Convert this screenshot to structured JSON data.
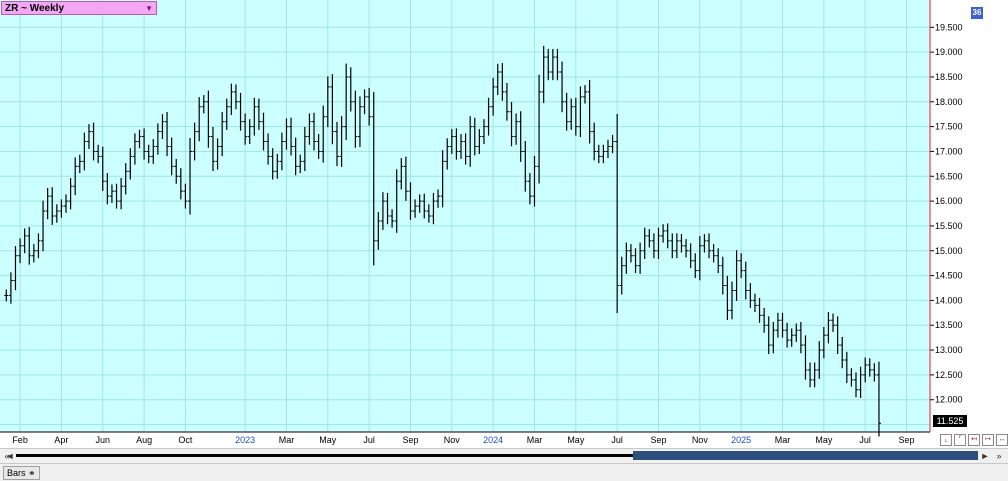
{
  "title": "ZR ~ Weekly",
  "badge": "36",
  "last_price_label": "11.525",
  "status_tab_label": "Bars",
  "status_tab_icon": "chain-link-icon",
  "nav": {
    "left_double": "«",
    "left": "◄",
    "right": "►",
    "right_double": "»"
  },
  "colors": {
    "plot_bg": "#ccffff",
    "grid": "#9fe6e6",
    "bars": "#000000",
    "cursor_line": "#e02020",
    "title_bg": "#f3a6f3"
  },
  "chart_data": {
    "type": "ohlc",
    "title": "ZR ~ Weekly",
    "xlabel": "",
    "ylabel": "",
    "y_axis_position": "right",
    "ylim": [
      11.35,
      20.05
    ],
    "yticks": [
      11.5,
      12.0,
      12.5,
      13.0,
      13.5,
      14.0,
      14.5,
      15.0,
      15.5,
      16.0,
      16.5,
      17.0,
      17.5,
      18.0,
      18.5,
      19.0,
      19.5
    ],
    "ytick_labels": [
      "",
      "12.000",
      "12.500",
      "13.000",
      "13.500",
      "14.000",
      "14.500",
      "15.000",
      "15.500",
      "16.000",
      "16.500",
      "17.000",
      "17.500",
      "18.000",
      "18.500",
      "19.000",
      "19.500"
    ],
    "grid": true,
    "x_labels": [
      {
        "text": "Feb",
        "week": 3,
        "year_label": false
      },
      {
        "text": "Apr",
        "week": 12,
        "year_label": false
      },
      {
        "text": "Jun",
        "week": 21,
        "year_label": false
      },
      {
        "text": "Aug",
        "week": 30,
        "year_label": false
      },
      {
        "text": "Oct",
        "week": 39,
        "year_label": false
      },
      {
        "text": "2023",
        "week": 52,
        "year_label": true
      },
      {
        "text": "Mar",
        "week": 61,
        "year_label": false
      },
      {
        "text": "May",
        "week": 70,
        "year_label": false
      },
      {
        "text": "Jul",
        "week": 79,
        "year_label": false
      },
      {
        "text": "Sep",
        "week": 88,
        "year_label": false
      },
      {
        "text": "Nov",
        "week": 97,
        "year_label": false
      },
      {
        "text": "2024",
        "week": 106,
        "year_label": true
      },
      {
        "text": "Mar",
        "week": 115,
        "year_label": false
      },
      {
        "text": "May",
        "week": 124,
        "year_label": false
      },
      {
        "text": "Jul",
        "week": 133,
        "year_label": false
      },
      {
        "text": "Sep",
        "week": 142,
        "year_label": false
      },
      {
        "text": "Nov",
        "week": 151,
        "year_label": false
      },
      {
        "text": "2025",
        "week": 160,
        "year_label": true
      },
      {
        "text": "Mar",
        "week": 169,
        "year_label": false
      },
      {
        "text": "May",
        "week": 178,
        "year_label": false
      },
      {
        "text": "Jul",
        "week": 187,
        "year_label": false
      },
      {
        "text": "Sep",
        "week": 196,
        "year_label": false
      }
    ],
    "close_series": [
      14.1,
      14.4,
      14.9,
      15.1,
      15.3,
      14.9,
      15.0,
      15.2,
      15.8,
      16.1,
      15.7,
      15.8,
      15.9,
      16.0,
      16.3,
      16.7,
      16.8,
      17.2,
      17.4,
      17.0,
      16.9,
      16.4,
      16.1,
      16.2,
      16.0,
      16.3,
      16.6,
      16.9,
      17.2,
      17.3,
      17.0,
      16.9,
      17.1,
      17.4,
      17.6,
      17.1,
      16.7,
      16.5,
      16.2,
      16.0,
      17.0,
      17.4,
      17.9,
      18.0,
      17.3,
      16.8,
      17.1,
      17.6,
      17.9,
      18.2,
      18.0,
      17.6,
      17.3,
      17.5,
      17.9,
      17.6,
      17.2,
      16.9,
      16.6,
      16.8,
      17.2,
      17.5,
      17.1,
      16.7,
      16.8,
      17.3,
      17.6,
      17.2,
      17.0,
      17.7,
      18.3,
      17.4,
      16.9,
      17.5,
      18.5,
      18.0,
      17.3,
      17.9,
      18.1,
      17.7,
      15.2,
      15.6,
      16.0,
      15.7,
      15.6,
      16.4,
      16.7,
      16.2,
      15.8,
      15.9,
      16.0,
      15.8,
      15.7,
      16.0,
      16.1,
      16.8,
      17.1,
      17.3,
      17.0,
      17.2,
      16.9,
      17.5,
      17.1,
      17.3,
      17.5,
      17.9,
      18.3,
      18.6,
      18.2,
      17.8,
      17.3,
      17.6,
      17.0,
      16.4,
      16.1,
      16.7,
      18.2,
      18.9,
      18.6,
      18.9,
      18.6,
      18.0,
      17.6,
      17.9,
      17.5,
      18.1,
      18.2,
      17.4,
      17.0,
      16.9,
      17.0,
      17.1,
      17.2,
      14.3,
      14.7,
      15.0,
      14.9,
      14.7,
      15.0,
      15.3,
      15.2,
      15.0,
      15.3,
      15.4,
      15.2,
      15.0,
      15.2,
      15.1,
      15.0,
      14.8,
      14.6,
      15.1,
      15.2,
      15.0,
      14.9,
      14.7,
      14.3,
      13.8,
      14.2,
      14.8,
      14.6,
      14.2,
      14.0,
      13.9,
      13.7,
      13.5,
      13.1,
      13.4,
      13.6,
      13.4,
      13.2,
      13.3,
      13.4,
      13.1,
      12.6,
      12.4,
      12.6,
      13.0,
      13.3,
      13.6,
      13.5,
      13.1,
      12.8,
      12.5,
      12.4,
      12.2,
      12.5,
      12.7,
      12.6,
      12.5,
      11.525
    ]
  }
}
